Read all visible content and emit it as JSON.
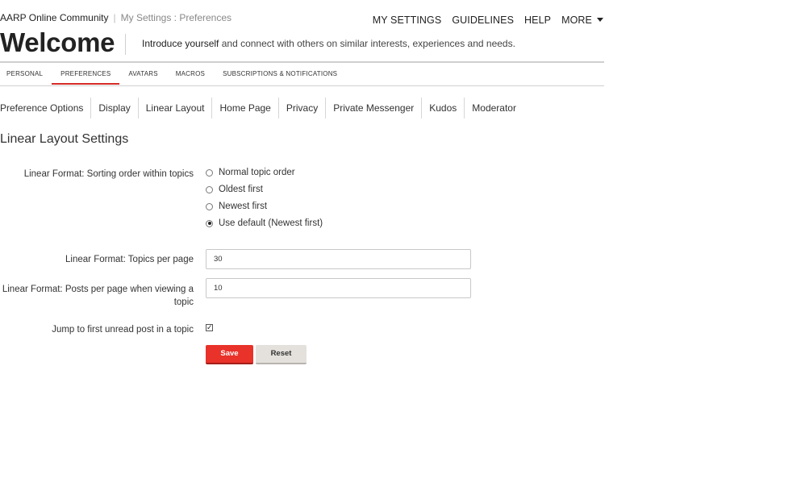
{
  "breadcrumb": {
    "site": "AARP Online Community",
    "separator": "|",
    "current": "My Settings : Preferences"
  },
  "top_nav": [
    "MY SETTINGS",
    "GUIDELINES",
    "HELP",
    "MORE"
  ],
  "header": {
    "title": "Welcome",
    "intro_bold": "Introduce yourself",
    "intro_rest": " and connect with others on similar interests, experiences and needs."
  },
  "tabs": [
    {
      "label": "PERSONAL",
      "active": false
    },
    {
      "label": "PREFERENCES",
      "active": true
    },
    {
      "label": "AVATARS",
      "active": false
    },
    {
      "label": "MACROS",
      "active": false
    },
    {
      "label": "SUBSCRIPTIONS & NOTIFICATIONS",
      "active": false
    }
  ],
  "subtabs": [
    "Preference Options",
    "Display",
    "Linear Layout",
    "Home Page",
    "Privacy",
    "Private Messenger",
    "Kudos",
    "Moderator"
  ],
  "section_title": "Linear Layout Settings",
  "sorting": {
    "label": "Linear Format: Sorting order within topics",
    "options": [
      {
        "label": "Normal topic order",
        "checked": false
      },
      {
        "label": "Oldest first",
        "checked": false
      },
      {
        "label": "Newest first",
        "checked": false
      },
      {
        "label": "Use default (Newest first)",
        "checked": true
      }
    ]
  },
  "topics_per_page": {
    "label": "Linear Format: Topics per page",
    "value": "30"
  },
  "posts_per_page": {
    "label_line1": "Linear Format: Posts per page when viewing a",
    "label_line2": "topic",
    "value": "10"
  },
  "jump_unread": {
    "label": "Jump to first unread post in a topic",
    "checked": true,
    "mark": "✓"
  },
  "buttons": {
    "save": "Save",
    "reset": "Reset"
  },
  "colors": {
    "accent": "#e8322a",
    "tab_underline": "#d42b26",
    "reset_bg": "#e4e1dc"
  }
}
